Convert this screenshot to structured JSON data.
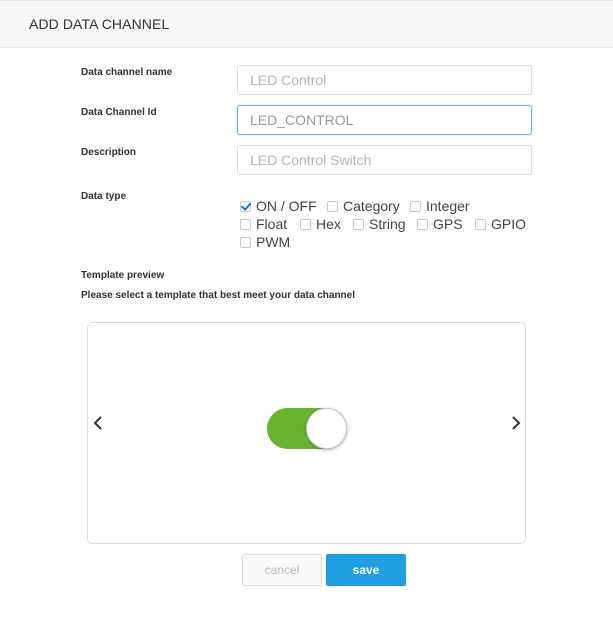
{
  "header": {
    "title": "ADD DATA CHANNEL"
  },
  "form": {
    "name_label": "Data channel name",
    "name_placeholder": "LED Control",
    "id_label": "Data Channel Id",
    "id_value": "LED_CONTROL",
    "description_label": "Description",
    "description_placeholder": "LED Control Switch",
    "data_type_label": "Data type",
    "data_types": [
      {
        "label": "ON / OFF",
        "checked": true
      },
      {
        "label": "Category",
        "checked": false
      },
      {
        "label": "Integer",
        "checked": false
      },
      {
        "label": "Float",
        "checked": false
      },
      {
        "label": "Hex",
        "checked": false
      },
      {
        "label": "String",
        "checked": false
      },
      {
        "label": "GPS",
        "checked": false
      },
      {
        "label": "GPIO",
        "checked": false
      },
      {
        "label": "PWM",
        "checked": false
      }
    ]
  },
  "template": {
    "title": "Template preview",
    "subtitle": "Please select a template that best meet your data channel",
    "toggle_on": true,
    "toggle_color": "#67b52f",
    "prev_icon": "chevron-left-icon",
    "next_icon": "chevron-right-icon"
  },
  "actions": {
    "cancel_label": "cancel",
    "save_label": "save",
    "save_color": "#1f9fe0"
  }
}
